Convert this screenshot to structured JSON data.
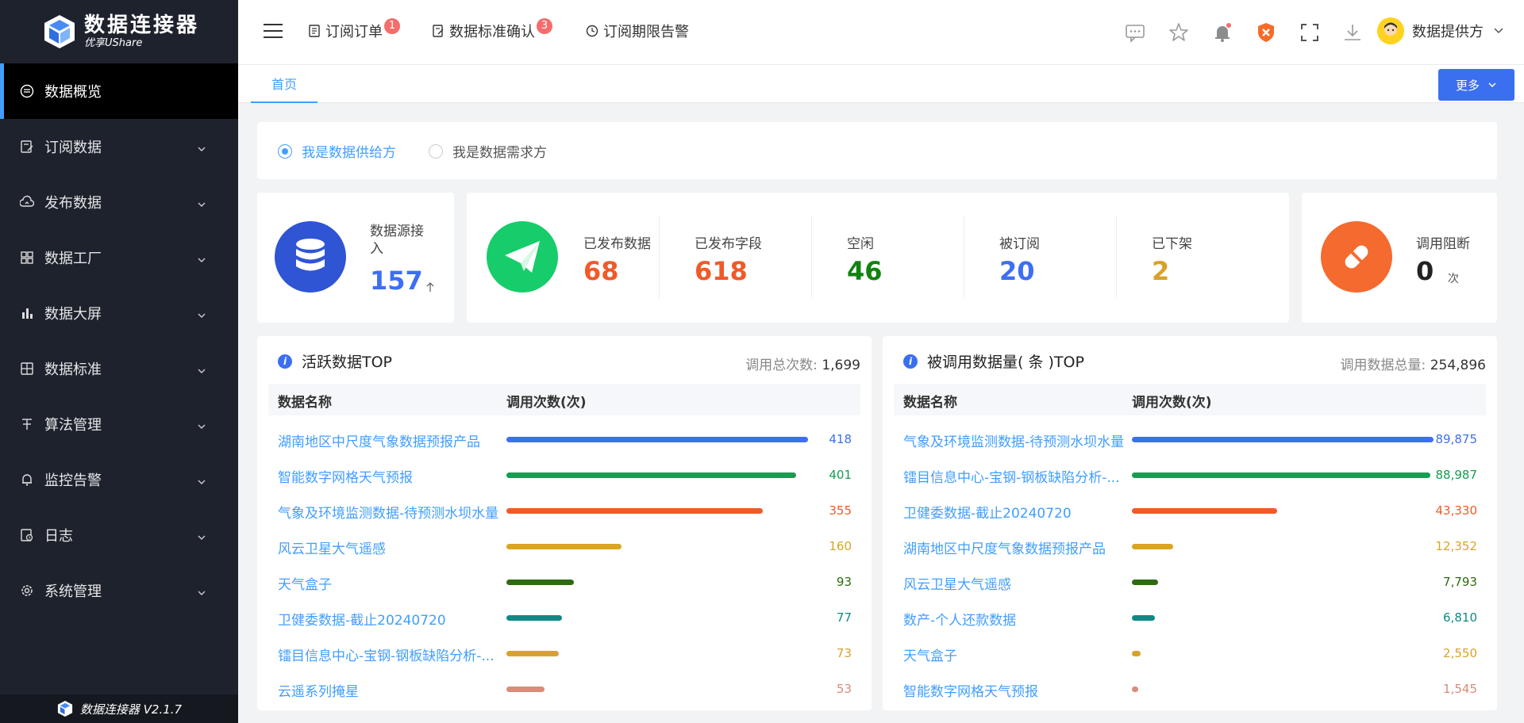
{
  "brand": {
    "title": "数据连接器",
    "subtitle": "优享UShare",
    "footer": "数据连接器 V2.1.7"
  },
  "sidebar": {
    "items": [
      {
        "label": "数据概览",
        "icon": "dashboard-icon",
        "active": true
      },
      {
        "label": "订阅数据",
        "icon": "subscribe-icon"
      },
      {
        "label": "发布数据",
        "icon": "cloud-upload-icon"
      },
      {
        "label": "数据工厂",
        "icon": "grid-icon"
      },
      {
        "label": "数据大屏",
        "icon": "bar-chart-icon"
      },
      {
        "label": "数据标准",
        "icon": "table-icon"
      },
      {
        "label": "算法管理",
        "icon": "algorithm-icon"
      },
      {
        "label": "监控告警",
        "icon": "bell-icon"
      },
      {
        "label": "日志",
        "icon": "log-icon"
      },
      {
        "label": "系统管理",
        "icon": "settings-icon"
      }
    ]
  },
  "header": {
    "nav": [
      {
        "label": "订阅订单",
        "badge": "1"
      },
      {
        "label": "数据标准确认",
        "badge": "3"
      },
      {
        "label": "订阅期限告警",
        "badge": ""
      }
    ],
    "user": "数据提供方"
  },
  "tabs": {
    "home": "首页",
    "more": "更多"
  },
  "role": {
    "provider": "我是数据供给方",
    "consumer": "我是数据需求方"
  },
  "stats": {
    "source": {
      "label": "数据源接入",
      "value": "157"
    },
    "published_data": {
      "label": "已发布数据",
      "value": "68"
    },
    "published_fields": {
      "label": "已发布字段",
      "value": "618"
    },
    "idle": {
      "label": "空闲",
      "value": "46"
    },
    "subscribed": {
      "label": "被订阅",
      "value": "20"
    },
    "offline": {
      "label": "已下架",
      "value": "2"
    },
    "blocked": {
      "label": "调用阻断",
      "value": "0",
      "unit": "次"
    }
  },
  "active_top": {
    "title": "活跃数据TOP",
    "total_label": "调用总次数:",
    "total": "1,699",
    "col_name": "数据名称",
    "col_count": "调用次数(次)",
    "max": 418,
    "rows": [
      {
        "name": "湖南地区中尺度气象数据预报产品",
        "value": 418,
        "display": "418",
        "color": "#3d6ff2"
      },
      {
        "name": "智能数字网格天气预报",
        "value": 401,
        "display": "401",
        "color": "#10a050"
      },
      {
        "name": "气象及环境监测数据-待预测水坝水量",
        "value": 355,
        "display": "355",
        "color": "#f05a28"
      },
      {
        "name": "风云卫星大气遥感",
        "value": 160,
        "display": "160",
        "color": "#daa520"
      },
      {
        "name": "天气盒子",
        "value": 93,
        "display": "93",
        "color": "#2f6b10"
      },
      {
        "name": "卫健委数据-截止20240720",
        "value": 77,
        "display": "77",
        "color": "#0e8a87"
      },
      {
        "name": "镭目信息中心-宝钢-钢板缺陷分析-...",
        "value": 73,
        "display": "73",
        "color": "#d8a22a"
      },
      {
        "name": "云遥系列掩星",
        "value": 53,
        "display": "53",
        "color": "#d98c78"
      }
    ]
  },
  "called_top": {
    "title": "被调用数据量( 条 )TOP",
    "total_label": "调用数据总量:",
    "total": "254,896",
    "col_name": "数据名称",
    "col_count": "调用次数(次)",
    "max": 89875,
    "rows": [
      {
        "name": "气象及环境监测数据-待预测水坝水量",
        "value": 89875,
        "display": "89,875",
        "color": "#3d6ff2"
      },
      {
        "name": "镭目信息中心-宝钢-钢板缺陷分析-...",
        "value": 88987,
        "display": "88,987",
        "color": "#10a050"
      },
      {
        "name": "卫健委数据-截止20240720",
        "value": 43330,
        "display": "43,330",
        "color": "#f05a28"
      },
      {
        "name": "湖南地区中尺度气象数据预报产品",
        "value": 12352,
        "display": "12,352",
        "color": "#daa520"
      },
      {
        "name": "风云卫星大气遥感",
        "value": 7793,
        "display": "7,793",
        "color": "#2f6b10"
      },
      {
        "name": "数产-个人还款数据",
        "value": 6810,
        "display": "6,810",
        "color": "#0e8a87"
      },
      {
        "name": "天气盒子",
        "value": 2550,
        "display": "2,550",
        "color": "#d8a22a"
      },
      {
        "name": "智能数字网格天气预报",
        "value": 1545,
        "display": "1,545",
        "color": "#d98c78"
      }
    ]
  }
}
